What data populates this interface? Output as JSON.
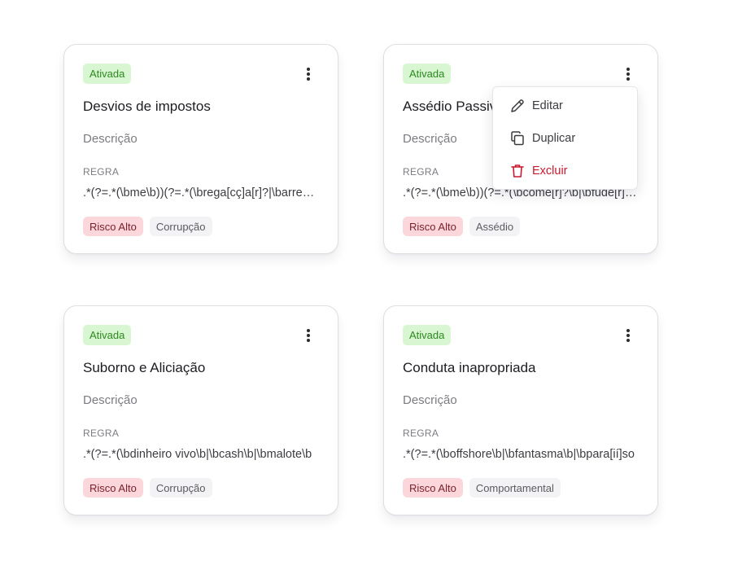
{
  "cards": [
    {
      "status": "Ativada",
      "title": "Desvios de impostos",
      "description": "Descrição",
      "rule_label": "REGRA",
      "rule_value": ".*(?=.*(\\bme\\b))(?=.*(\\brega[cç]a[r]?|\\barrego[u]?|\\bsonegar",
      "risk": "Risco Alto",
      "category": "Corrupção"
    },
    {
      "status": "Ativada",
      "title": "Assédio Passivo",
      "description": "Descrição",
      "rule_label": "REGRA",
      "rule_value": ".*(?=.*(\\bme\\b))(?=.*(\\bcome[r]?\\b|\\bfude[r]?\\b",
      "risk": "Risco Alto",
      "category": "Assédio"
    },
    {
      "status": "Ativada",
      "title": "Suborno e Aliciação",
      "description": "Descrição",
      "rule_label": "REGRA",
      "rule_value": ".*(?=.*(\\bdinheiro vivo\\b|\\bcash\\b|\\bmalote\\b",
      "risk": "Risco Alto",
      "category": "Corrupção"
    },
    {
      "status": "Ativada",
      "title": "Conduta inapropriada",
      "description": "Descrição",
      "rule_label": "REGRA",
      "rule_value": ".*(?=.*(\\boffshore\\b|\\bfantasma\\b|\\bpara[ií]so",
      "risk": "Risco Alto",
      "category": "Comportamental"
    }
  ],
  "context_menu": {
    "edit_label": "Editar",
    "duplicate_label": "Duplicar",
    "delete_label": "Excluir"
  },
  "colors": {
    "status_bg": "#d9f6d2",
    "status_text": "#2c8a1f",
    "risk_bg": "#fbd6db",
    "risk_text": "#7a1f2b",
    "delete_text": "#c9182f"
  },
  "icons": {
    "card_menu": "kebab-vertical-icon",
    "edit": "pencil-icon",
    "duplicate": "copy-icon",
    "delete": "trash-icon"
  }
}
